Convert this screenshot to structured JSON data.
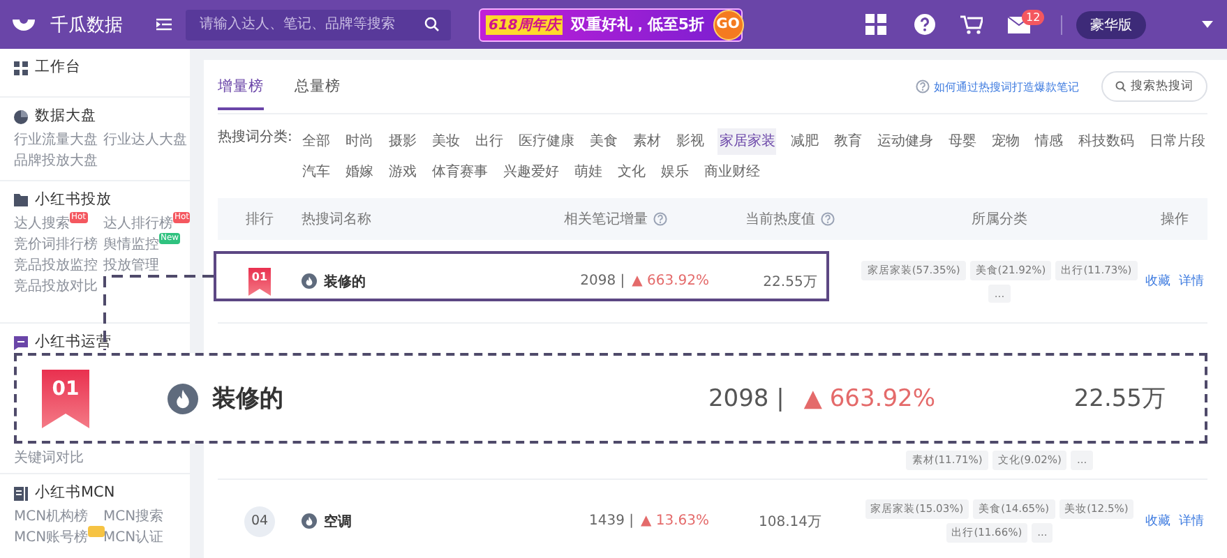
{
  "header": {
    "brand": "千瓜数据",
    "search": {
      "placeholder": "请输入达人、笔记、品牌等搜索"
    },
    "promo": {
      "tag": "618周年庆",
      "text": "双重好礼，低至5折",
      "button": "GO"
    },
    "mail_count": "12",
    "plan": "豪华版"
  },
  "sidebar": [
    {
      "title": "工作台"
    },
    {
      "title": "数据大盘",
      "items": [
        {
          "label": "行业流量大盘"
        },
        {
          "label": "行业达人大盘"
        },
        {
          "label": "品牌投放大盘"
        }
      ]
    },
    {
      "title": "小红书投放",
      "items": [
        {
          "label": "达人搜索",
          "badge": "Hot",
          "color": "#f4575f"
        },
        {
          "label": "达人排行榜",
          "badge": "Hot",
          "color": "#f4575f"
        },
        {
          "label": "竞价词排行榜"
        },
        {
          "label": "舆情监控",
          "badge": "New",
          "color": "#2fc27f"
        },
        {
          "label": "竞品投放监控"
        },
        {
          "label": "投放管理"
        },
        {
          "label": "竞品投放对比"
        }
      ]
    },
    {
      "title": "小红书运营",
      "items": [
        {
          "label": "关键词对比"
        }
      ]
    },
    {
      "title": "小红书MCN",
      "items": [
        {
          "label": "MCN机构榜"
        },
        {
          "label": "MCN搜索"
        },
        {
          "label": "MCN账号榜",
          "color": "#f6c343"
        },
        {
          "label": "MCN认证"
        }
      ]
    }
  ],
  "tabs": [
    {
      "label": "增量榜",
      "selected": true
    },
    {
      "label": "总量榜",
      "selected": false
    }
  ],
  "help_link": "如何通过热搜词打造爆款笔记",
  "search_button": "搜索热搜词",
  "filter": {
    "label": "热搜词分类:",
    "options": [
      {
        "label": "全部",
        "selected": false
      },
      {
        "label": "时尚",
        "selected": false
      },
      {
        "label": "摄影",
        "selected": false
      },
      {
        "label": "美妆",
        "selected": false
      },
      {
        "label": "出行",
        "selected": false
      },
      {
        "label": "医疗健康",
        "selected": false
      },
      {
        "label": "美食",
        "selected": false
      },
      {
        "label": "素材",
        "selected": false
      },
      {
        "label": "影视",
        "selected": false
      },
      {
        "label": "家居家装",
        "selected": true
      },
      {
        "label": "减肥",
        "selected": false
      },
      {
        "label": "教育",
        "selected": false
      },
      {
        "label": "运动健身",
        "selected": false
      },
      {
        "label": "母婴",
        "selected": false
      },
      {
        "label": "宠物",
        "selected": false
      },
      {
        "label": "情感",
        "selected": false
      },
      {
        "label": "科技数码",
        "selected": false
      },
      {
        "label": "日常片段",
        "selected": false
      },
      {
        "label": "汽车",
        "selected": false
      },
      {
        "label": "婚嫁",
        "selected": false
      },
      {
        "label": "游戏",
        "selected": false
      },
      {
        "label": "体育赛事",
        "selected": false
      },
      {
        "label": "兴趣爱好",
        "selected": false
      },
      {
        "label": "萌娃",
        "selected": false
      },
      {
        "label": "文化",
        "selected": false
      },
      {
        "label": "娱乐",
        "selected": false
      },
      {
        "label": "商业财经",
        "selected": false
      }
    ]
  },
  "table": {
    "columns": [
      "排行",
      "热搜词名称",
      "相关笔记增量",
      "当前热度值",
      "所属分类",
      "操作"
    ],
    "rows": [
      {
        "kind": "top",
        "rank": "01",
        "name": "装修的",
        "count": "2098 |",
        "growth": "▲ 663.92%",
        "heat": "22.55万",
        "tags": [
          "家居家装(57.35%)",
          "美食(21.92%)",
          "出行(11.73%)",
          "..."
        ],
        "actions": [
          "收藏",
          "详情"
        ]
      },
      {
        "kind": "partial",
        "tags": [
          "素材(11.71%)",
          "文化(9.02%)",
          "..."
        ]
      },
      {
        "kind": "plain",
        "rank": "04",
        "name": "空调",
        "count": "1439 |",
        "growth": "▲ 13.63%",
        "heat": "108.14万",
        "tags": [
          "家居家装(15.03%)",
          "美食(14.65%)",
          "美妆(12.5%)",
          "出行(11.66%)",
          "..."
        ],
        "actions": [
          "收藏",
          "详情"
        ]
      }
    ]
  },
  "callout": {
    "rank": "01",
    "name": "装修的",
    "count": "2098 |",
    "growth": "▲ 663.92%",
    "heat": "22.55万"
  }
}
